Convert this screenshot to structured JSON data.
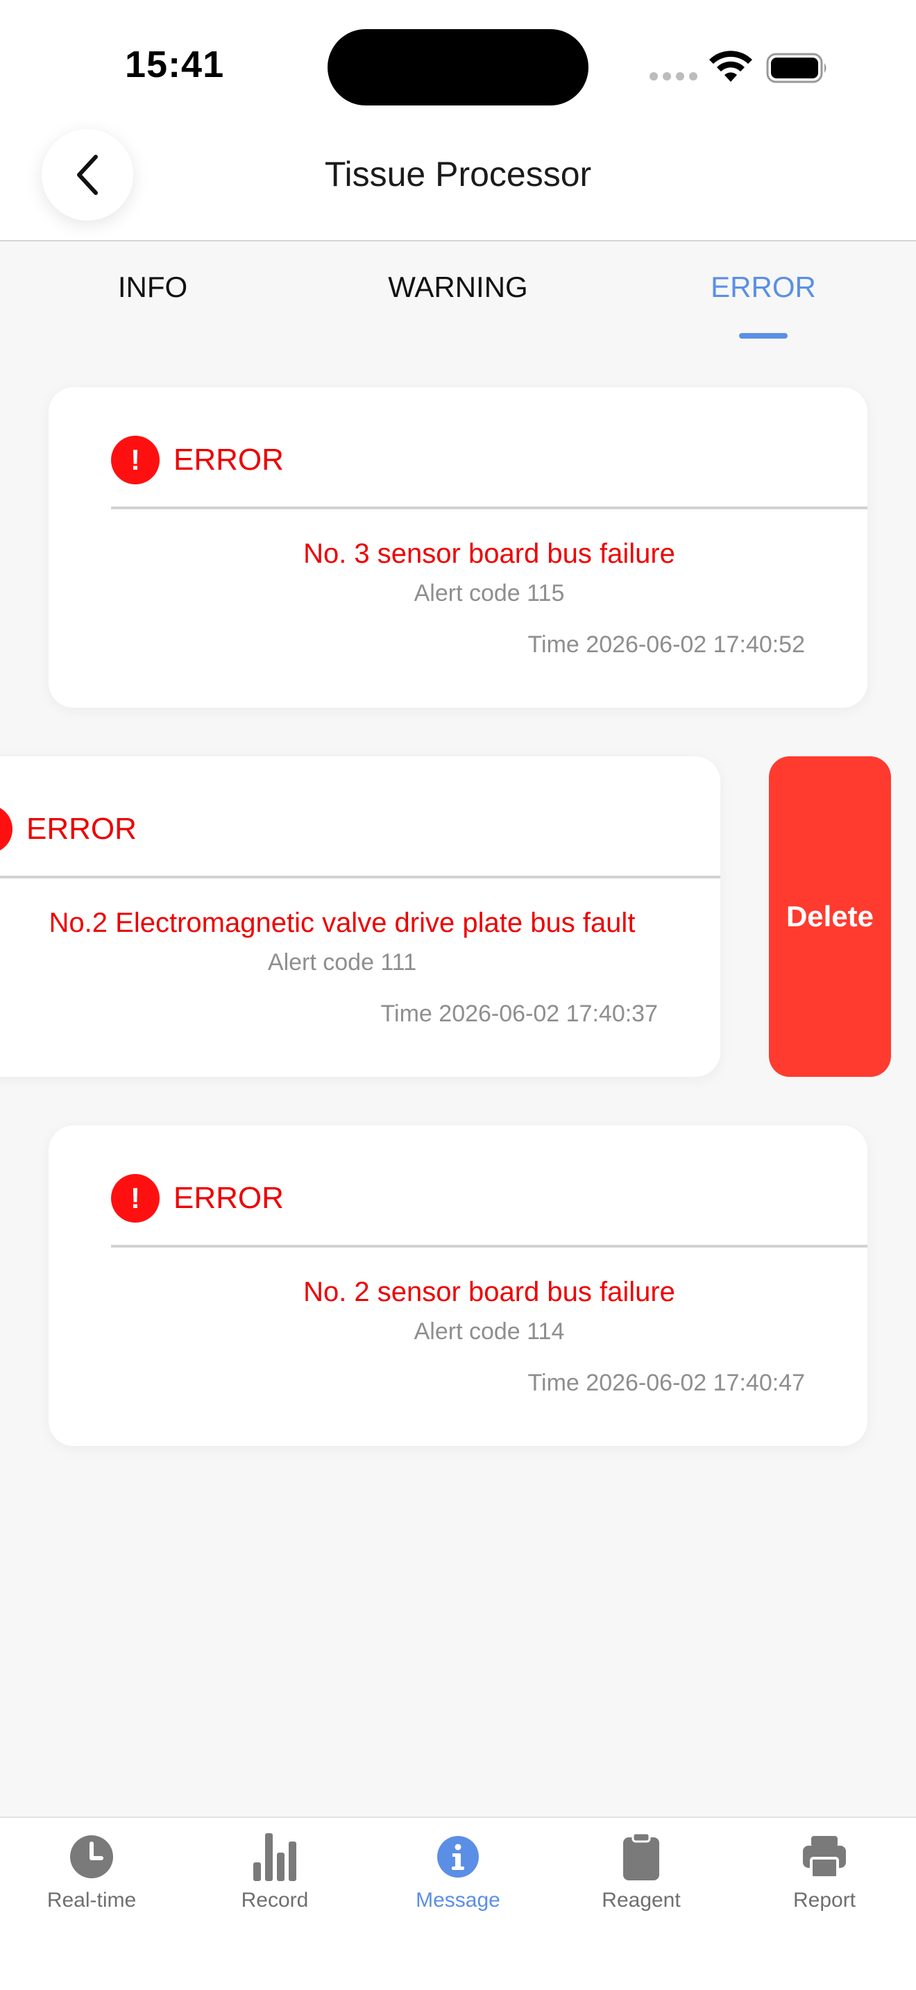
{
  "status_bar": {
    "time": "15:41"
  },
  "header": {
    "title": "Tissue Processor"
  },
  "tabs": [
    {
      "label": "INFO",
      "active": false
    },
    {
      "label": "WARNING",
      "active": false
    },
    {
      "label": "ERROR",
      "active": true
    }
  ],
  "messages": [
    {
      "level": "ERROR",
      "message": "No. 3 sensor board bus failure",
      "code": "Alert code 115",
      "time": "Time 2026-06-02 17:40:52",
      "swiped": false
    },
    {
      "level": "ERROR",
      "message": "No.2 Electromagnetic valve drive plate bus fault",
      "code": "Alert code 111",
      "time": "Time 2026-06-02 17:40:37",
      "swiped": true
    },
    {
      "level": "ERROR",
      "message": "No. 2 sensor board bus failure",
      "code": "Alert code 114",
      "time": "Time 2026-06-02 17:40:47",
      "swiped": false
    }
  ],
  "delete_label": "Delete",
  "bottom_nav": [
    {
      "label": "Real-time",
      "icon": "clock-icon",
      "active": false
    },
    {
      "label": "Record",
      "icon": "bar-chart-icon",
      "active": false
    },
    {
      "label": "Message",
      "icon": "info-icon",
      "active": true
    },
    {
      "label": "Reagent",
      "icon": "clipboard-icon",
      "active": false
    },
    {
      "label": "Report",
      "icon": "printer-icon",
      "active": false
    }
  ],
  "colors": {
    "accent": "#5b8fe6",
    "error": "#ee0000",
    "delete": "#ff3b30"
  }
}
